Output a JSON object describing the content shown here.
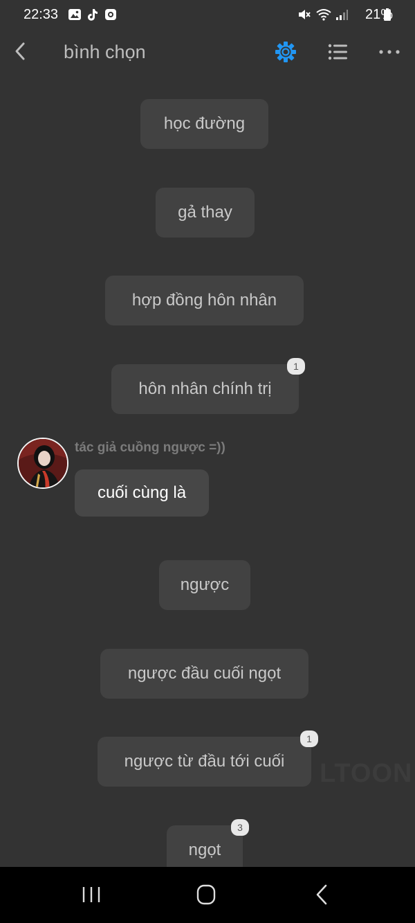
{
  "status_bar": {
    "time": "22:33",
    "battery": "21%"
  },
  "header": {
    "title": "bình chọn"
  },
  "choices": [
    {
      "label": "học đường"
    },
    {
      "label": "gả thay"
    },
    {
      "label": "hợp đồng hôn nhân"
    },
    {
      "label": "hôn nhân chính trị",
      "badge": "1"
    },
    {
      "label": "ngược"
    },
    {
      "label": "ngược đầu cuối ngọt"
    },
    {
      "label": "ngược từ đầu tới cuối",
      "badge": "1"
    },
    {
      "label": "ngọt",
      "badge": "3"
    }
  ],
  "message": {
    "author": "tác giả cuồng ngược =))",
    "text": "cuối cùng là"
  },
  "watermark": "LTOON",
  "colors": {
    "background": "#333333",
    "settings_accent": "#2196f3",
    "choice_bg": "#424242"
  },
  "icons": [
    "back-icon",
    "settings-icon",
    "list-icon",
    "more-icon",
    "nav-recents-icon",
    "nav-home-icon",
    "nav-back-icon"
  ]
}
